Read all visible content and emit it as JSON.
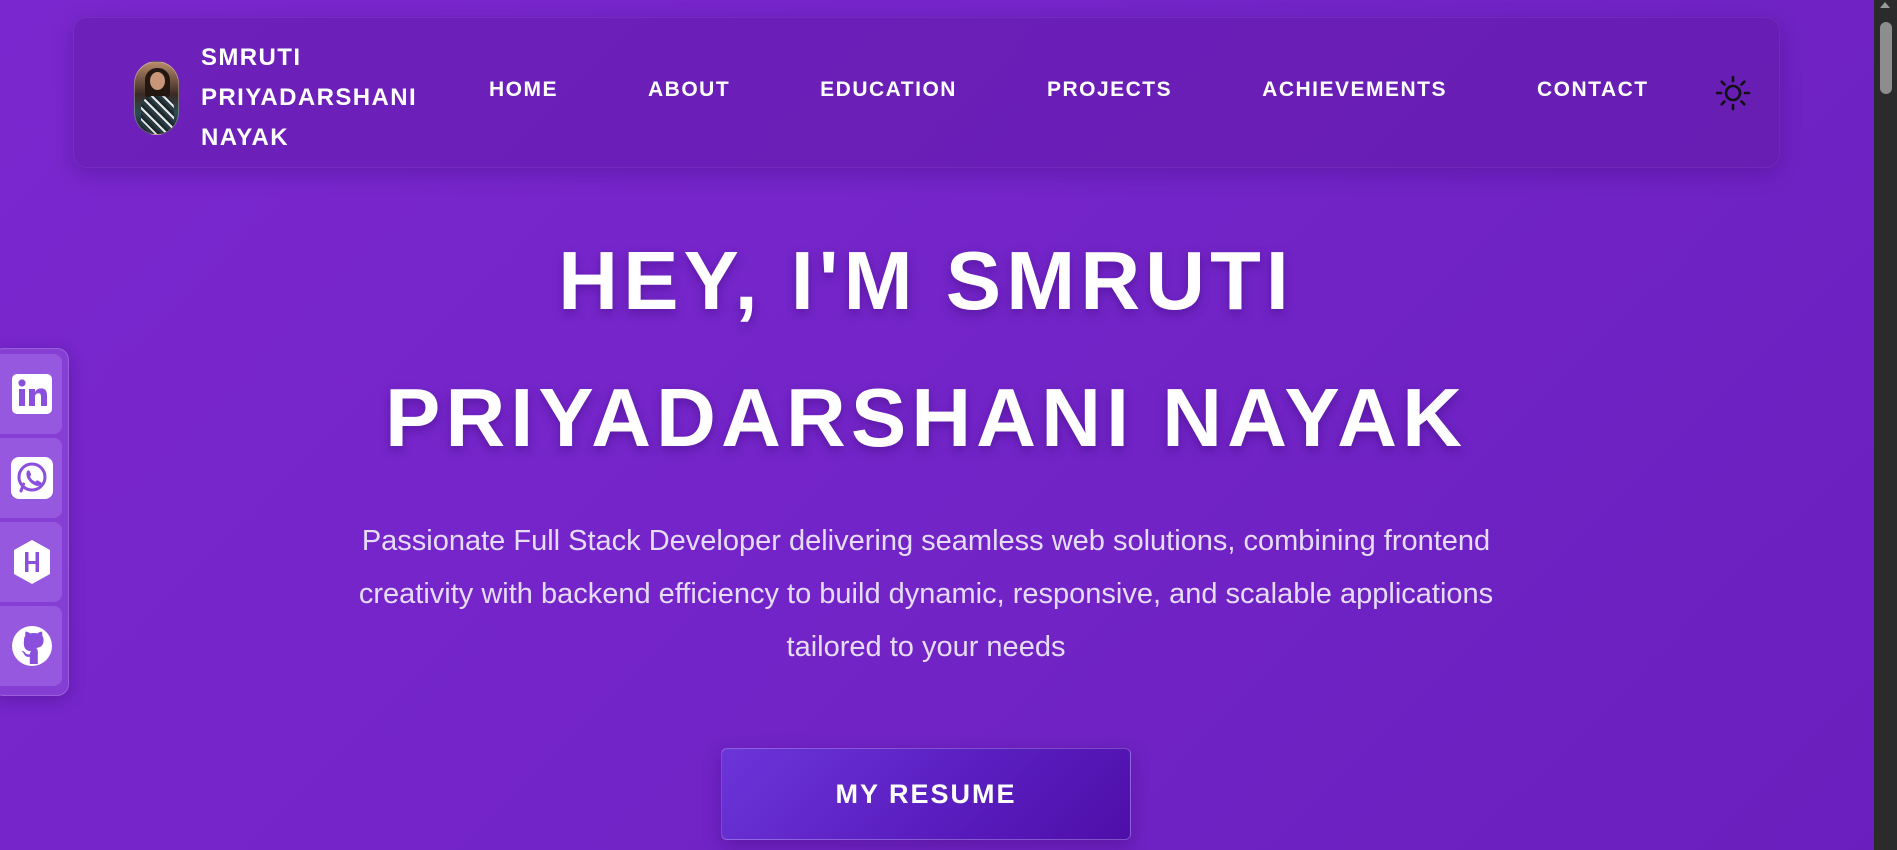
{
  "brand": {
    "name_lines": [
      "SMRUTI",
      "PRIYADARSHANI",
      "NAYAK"
    ],
    "avatar_icon": "profile-photo"
  },
  "nav": {
    "links": [
      "HOME",
      "ABOUT",
      "EDUCATION",
      "PROJECTS",
      "ACHIEVEMENTS",
      "CONTACT"
    ],
    "theme_toggle_icon": "sun-icon"
  },
  "social": {
    "items": [
      {
        "icon": "linkedin-icon"
      },
      {
        "icon": "whatsapp-icon"
      },
      {
        "icon": "hackerrank-icon"
      },
      {
        "icon": "github-icon"
      }
    ]
  },
  "hero": {
    "title_lines": [
      "HEY, I'M SMRUTI",
      "PRIYADARSHANI NAYAK"
    ],
    "description": "Passionate Full Stack Developer delivering seamless web solutions, combining frontend creativity with backend efficiency to build dynamic, responsive, and scalable applications tailored to your needs",
    "resume_label": "MY RESUME"
  },
  "colors": {
    "background": "#7324c8",
    "accent": "#5a1ec0",
    "text": "#ffffff",
    "muted_text": "#e6dcf6"
  }
}
